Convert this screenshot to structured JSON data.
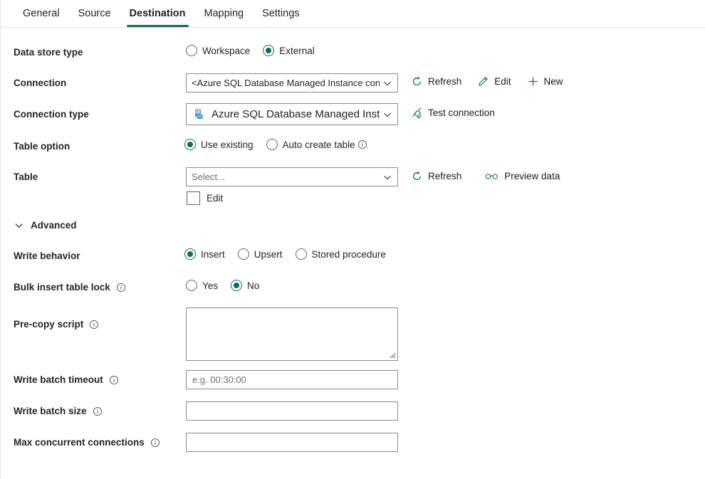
{
  "tabs": [
    {
      "label": "General",
      "selected": false
    },
    {
      "label": "Source",
      "selected": false
    },
    {
      "label": "Destination",
      "selected": true
    },
    {
      "label": "Mapping",
      "selected": false
    },
    {
      "label": "Settings",
      "selected": false
    }
  ],
  "accent_color": "#0f6b5c",
  "form": {
    "data_store_type": {
      "label": "Data store type",
      "options": [
        {
          "label": "Workspace",
          "selected": false
        },
        {
          "label": "External",
          "selected": true
        }
      ]
    },
    "connection": {
      "label": "Connection",
      "value": "<Azure SQL Database Managed Instance connection>",
      "actions": [
        {
          "label": "Refresh",
          "icon": "refresh-icon"
        },
        {
          "label": "Edit",
          "icon": "pencil-icon"
        },
        {
          "label": "New",
          "icon": "plus-icon"
        }
      ]
    },
    "connection_type": {
      "label": "Connection type",
      "value": "Azure SQL Database Managed Insta...",
      "icon": "azure-sql-database-icon",
      "actions": [
        {
          "label": "Test connection",
          "icon": "test-connection-icon"
        }
      ]
    },
    "table_option": {
      "label": "Table option",
      "options": [
        {
          "label": "Use existing",
          "selected": true,
          "info": false
        },
        {
          "label": "Auto create table",
          "selected": false,
          "info": true
        }
      ]
    },
    "table": {
      "label": "Table",
      "placeholder": "Select...",
      "edit_checkbox_label": "Edit",
      "edit_checked": false,
      "actions": [
        {
          "label": "Refresh",
          "icon": "refresh-icon"
        },
        {
          "label": "Preview data",
          "icon": "glasses-icon"
        }
      ]
    },
    "advanced": {
      "label": "Advanced",
      "expanded": true
    },
    "write_behavior": {
      "label": "Write behavior",
      "options": [
        {
          "label": "Insert",
          "selected": true
        },
        {
          "label": "Upsert",
          "selected": false
        },
        {
          "label": "Stored procedure",
          "selected": false
        }
      ]
    },
    "bulk_insert_table_lock": {
      "label": "Bulk insert table lock",
      "info": true,
      "options": [
        {
          "label": "Yes",
          "selected": false
        },
        {
          "label": "No",
          "selected": true
        }
      ]
    },
    "pre_copy_script": {
      "label": "Pre-copy script",
      "info": true,
      "value": "",
      "placeholder": ""
    },
    "write_batch_timeout": {
      "label": "Write batch timeout",
      "info": true,
      "value": "",
      "placeholder": "e.g. 00:30:00"
    },
    "write_batch_size": {
      "label": "Write batch size",
      "info": true,
      "value": "",
      "placeholder": ""
    },
    "max_concurrent_connections": {
      "label": "Max concurrent connections",
      "info": true,
      "value": "",
      "placeholder": ""
    }
  }
}
